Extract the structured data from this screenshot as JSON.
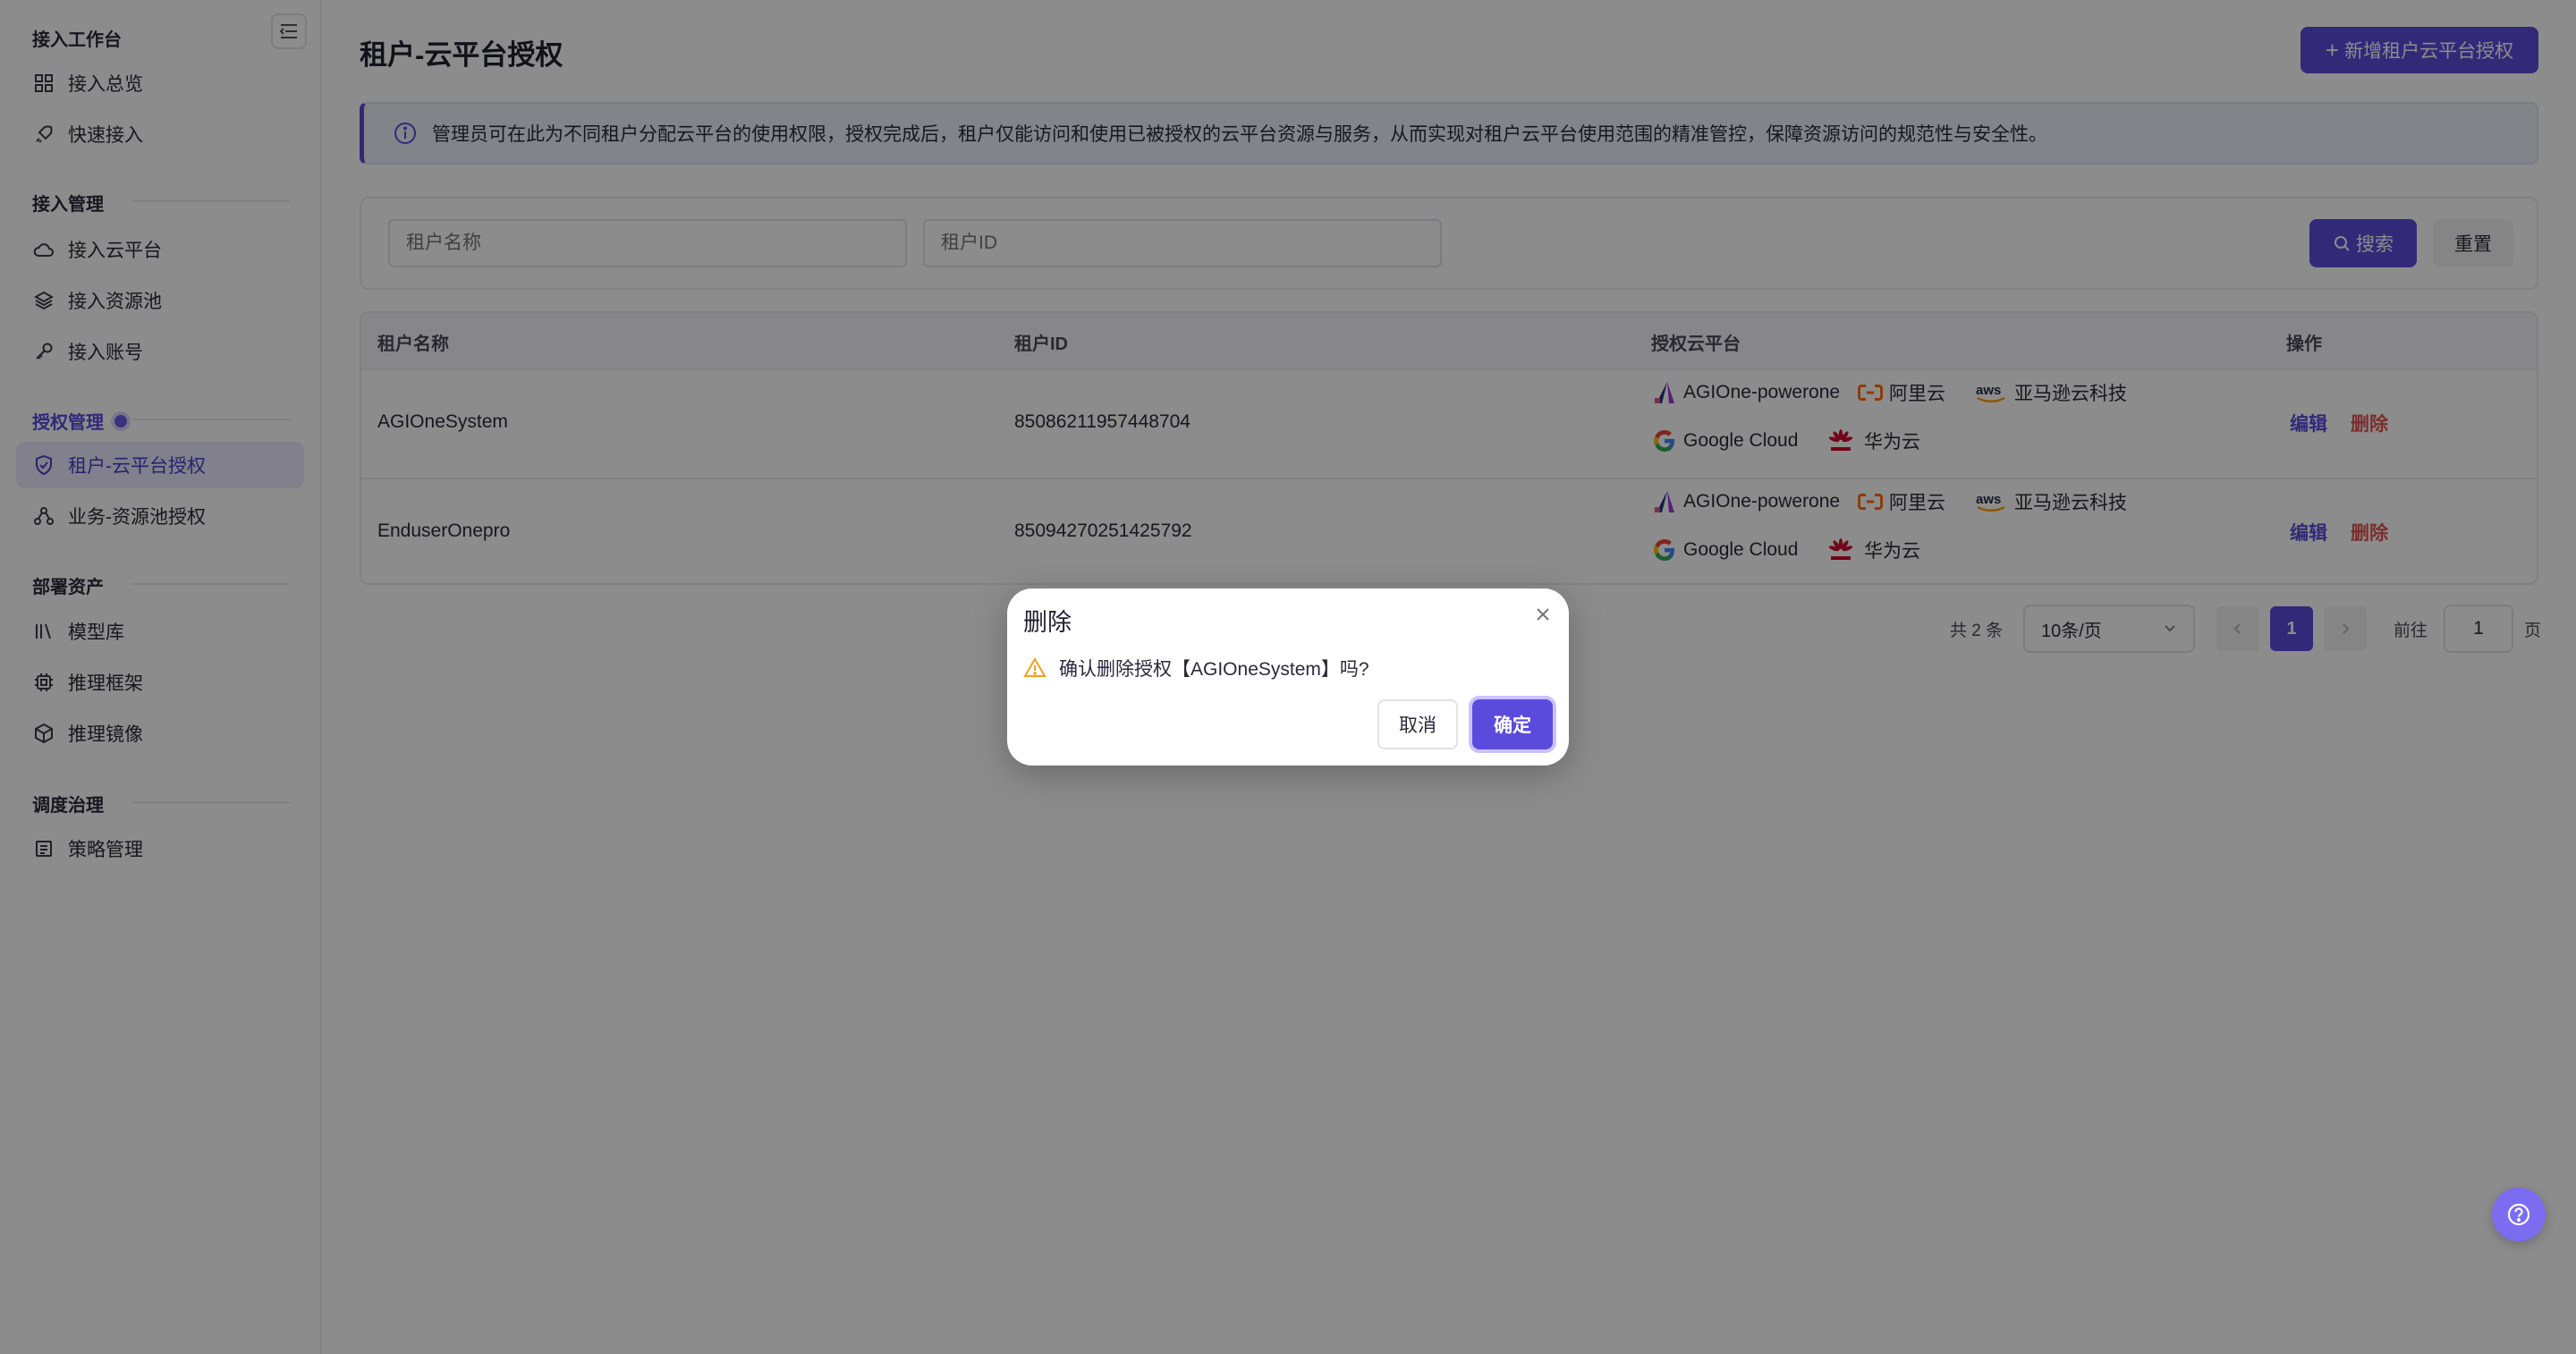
{
  "sidebar": {
    "groups": [
      {
        "title": "接入工作台",
        "items": [
          {
            "label": "接入总览",
            "icon": "grid-icon"
          },
          {
            "label": "快速接入",
            "icon": "rocket-icon"
          }
        ]
      },
      {
        "title": "接入管理",
        "items": [
          {
            "label": "接入云平台",
            "icon": "cloud-icon"
          },
          {
            "label": "接入资源池",
            "icon": "layers-icon"
          },
          {
            "label": "接入账号",
            "icon": "key-icon"
          }
        ]
      },
      {
        "title": "授权管理",
        "items": [
          {
            "label": "租户-云平台授权",
            "icon": "shield-check-icon",
            "active": true
          },
          {
            "label": "业务-资源池授权",
            "icon": "hierarchy-icon"
          }
        ]
      },
      {
        "title": "部署资产",
        "items": [
          {
            "label": "模型库",
            "icon": "library-icon"
          },
          {
            "label": "推理框架",
            "icon": "chip-icon"
          },
          {
            "label": "推理镜像",
            "icon": "box-icon"
          }
        ]
      },
      {
        "title": "调度治理",
        "items": [
          {
            "label": "策略管理",
            "icon": "policy-icon"
          }
        ]
      }
    ]
  },
  "header": {
    "title": "租户-云平台授权",
    "add_button": "新增租户云平台授权"
  },
  "info": {
    "text": "管理员可在此为不同租户分配云平台的使用权限，授权完成后，租户仅能访问和使用已被授权的云平台资源与服务，从而实现对租户云平台使用范围的精准管控，保障资源访问的规范性与安全性。"
  },
  "filter": {
    "tenant_name_placeholder": "租户名称",
    "tenant_id_placeholder": "租户ID",
    "search_label": "搜索",
    "reset_label": "重置"
  },
  "table": {
    "columns": [
      "租户名称",
      "租户ID",
      "授权云平台",
      "操作"
    ],
    "rows": [
      {
        "name": "AGIOneSystem",
        "id": "85086211957448704",
        "platforms": [
          "AGIOne-powerone",
          "阿里云",
          "亚马逊云科技",
          "Google Cloud",
          "华为云"
        ],
        "edit": "编辑",
        "delete": "删除"
      },
      {
        "name": "EnduserOnepro",
        "id": "85094270251425792",
        "platforms": [
          "AGIOne-powerone",
          "阿里云",
          "亚马逊云科技",
          "Google Cloud",
          "华为云"
        ],
        "edit": "编辑",
        "delete": "删除"
      }
    ]
  },
  "pagination": {
    "total": "共 2 条",
    "page_size": "10条/页",
    "current_page": "1",
    "goto_label": "前往",
    "goto_value": "1",
    "page_unit": "页"
  },
  "modal": {
    "title": "删除",
    "message": "确认删除授权【AGIOneSystem】吗?",
    "cancel": "取消",
    "confirm": "确定"
  },
  "colors": {
    "accent": "#5b4bdc",
    "danger": "#e0524f",
    "warning": "#f0a020"
  }
}
